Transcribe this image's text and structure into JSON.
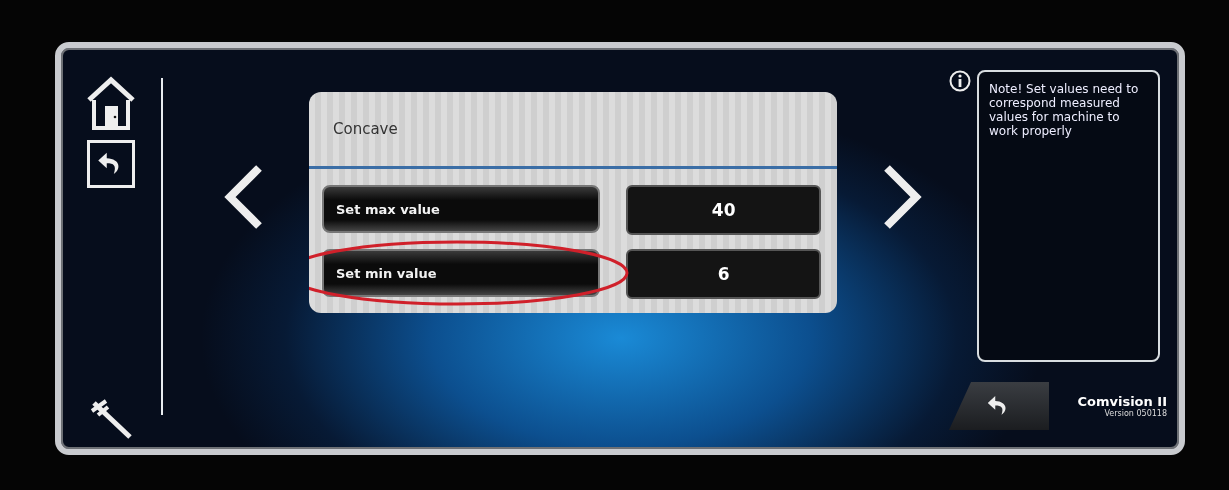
{
  "panel": {
    "title": "Concave",
    "rows": [
      {
        "label": "Set max value",
        "value": "40",
        "annotated": false
      },
      {
        "label": "Set min value",
        "value": "6",
        "annotated": true
      }
    ]
  },
  "note": {
    "text": "Note! Set values need to correspond measured values for machine to work properly"
  },
  "brand": {
    "name": "Comvision II",
    "version": "Version 050118"
  }
}
